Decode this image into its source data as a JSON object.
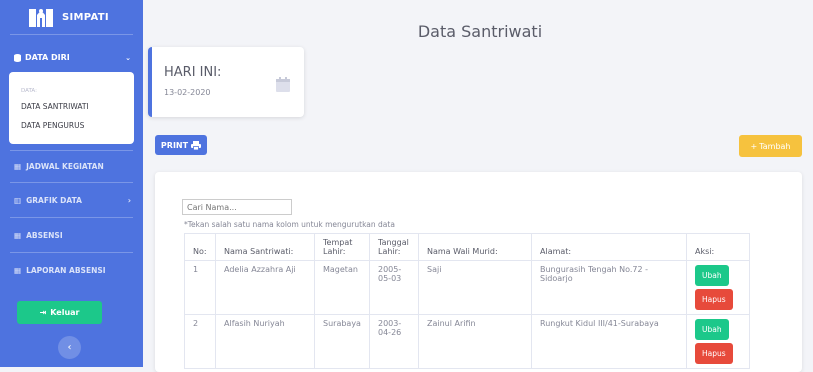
{
  "brand": {
    "name": "SIMPATI"
  },
  "sidebar": {
    "section_label": "DATA DIRI",
    "submenu_header": "DATA:",
    "submenu_items": [
      "DATA SANTRIWATI",
      "DATA PENGURUS"
    ],
    "items": [
      {
        "label": "JADWAL KEGIATAN",
        "icon": "calendar-icon",
        "chevron": ""
      },
      {
        "label": "GRAFIK DATA",
        "icon": "chart-icon",
        "chevron": "›"
      },
      {
        "label": "ABSENSI",
        "icon": "calendar-icon",
        "chevron": ""
      },
      {
        "label": "LAPORAN ABSENSI",
        "icon": "calendar-icon",
        "chevron": ""
      }
    ],
    "logout_label": "Keluar",
    "toggle_glyph": "‹"
  },
  "page": {
    "title": "Data Santriwati"
  },
  "today_card": {
    "label": "HARI INI:",
    "date": "13-02-2020"
  },
  "print_label": "PRINT",
  "tambah_label": "Tambah",
  "search": {
    "placeholder": "Cari Nama..."
  },
  "hint": "*Tekan salah satu nama kolom untuk mengurutkan data",
  "table": {
    "headers": [
      "No:",
      "Nama Santriwati:",
      "Tempat Lahir:",
      "Tanggal Lahir:",
      "Nama Wali Murid:",
      "Alamat:",
      "Aksi:"
    ],
    "rows": [
      {
        "no": "1",
        "nama": "Adelia Azzahra Aji",
        "tempat": "Magetan",
        "tanggal": "2005-05-03",
        "wali": "Saji",
        "alamat": "Bungurasih Tengah No.72 - Sidoarjo",
        "ubah": "Ubah",
        "hapus": "Hapus"
      },
      {
        "no": "2",
        "nama": "Alfasih Nuriyah",
        "tempat": "Surabaya",
        "tanggal": "2003-04-26",
        "wali": "Zainul Arifin",
        "alamat": "Rungkut Kidul III/41-Surabaya",
        "ubah": "Ubah",
        "hapus": "Hapus"
      }
    ]
  },
  "colors": {
    "primary": "#4e73df",
    "success": "#1cc88a",
    "danger": "#e74a3b",
    "warning": "#f6c23e"
  }
}
